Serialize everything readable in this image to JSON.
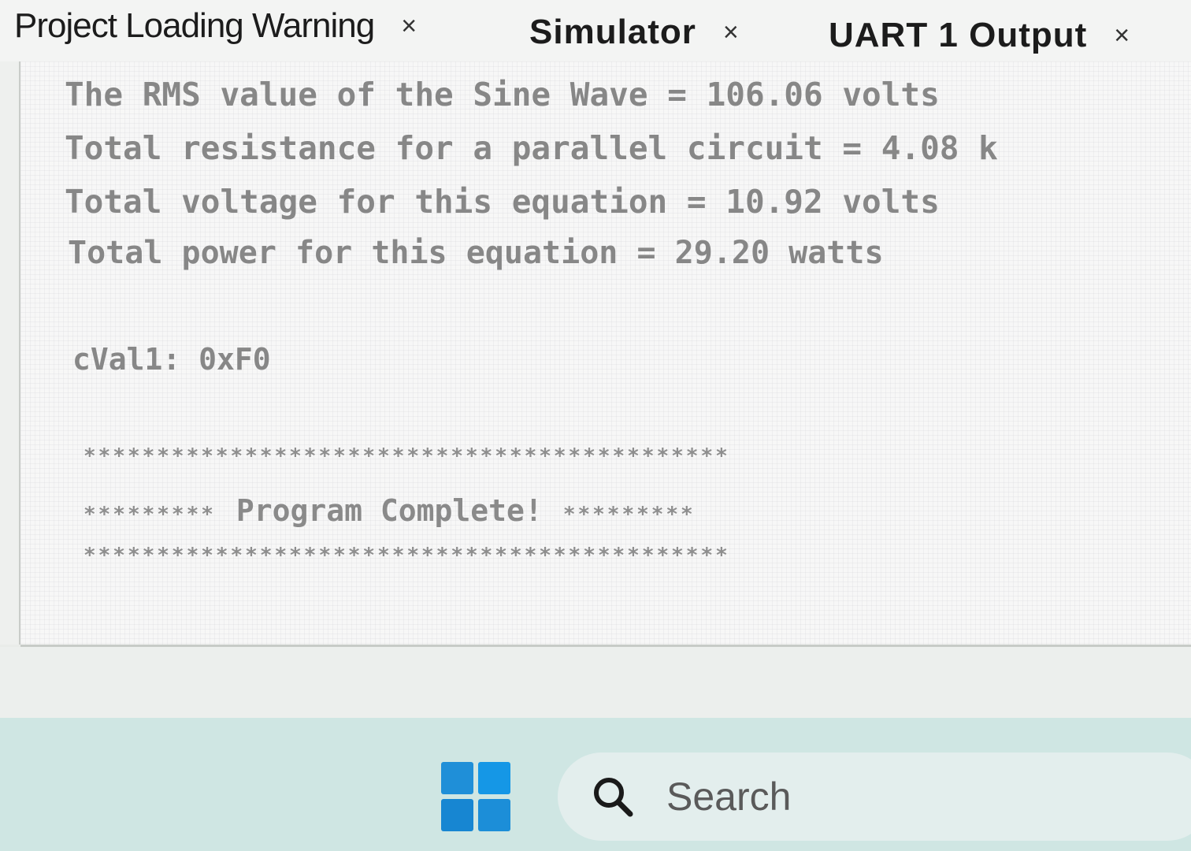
{
  "tabs": [
    {
      "label": "Project Loading Warning",
      "close": "×"
    },
    {
      "label": "Simulator",
      "close": "×"
    },
    {
      "label": "UART 1 Output",
      "close": "×"
    }
  ],
  "console": {
    "lines": [
      "The RMS value of the Sine Wave = 106.06 volts",
      "Total resistance for a parallel circuit = 4.08 k",
      "Total voltage for this equation = 10.92 volts",
      "Total power for this equation = 29.20 watts",
      "cVal1: 0xF0"
    ],
    "stars_full": "********************************************",
    "stars_short": "*********",
    "program_message": "Program Complete!"
  },
  "taskbar": {
    "search_placeholder": "Search",
    "start_icon": "windows-logo-icon",
    "search_icon": "search-icon",
    "accent_color": "#1f8fd8"
  }
}
